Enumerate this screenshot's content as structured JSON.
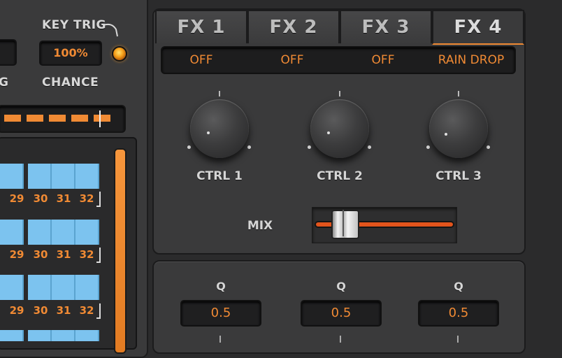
{
  "key_trig": {
    "label": "KEY TRIG",
    "chance_value": "100%",
    "chance_label": "CHANCE",
    "cut_label": "G"
  },
  "steps": {
    "numbers": [
      "29",
      "30",
      "31",
      "32"
    ]
  },
  "fx": {
    "tabs": [
      "FX 1",
      "FX 2",
      "FX 3",
      "FX 4"
    ],
    "active_tab": "FX 4",
    "slots": [
      "OFF",
      "OFF",
      "OFF",
      "RAIN DROP"
    ],
    "knobs": [
      {
        "label": "CTRL 1"
      },
      {
        "label": "CTRL 2"
      },
      {
        "label": "CTRL 3"
      }
    ],
    "mix_label": "MIX"
  },
  "q_section": {
    "label": "Q",
    "values": [
      "0.5",
      "0.5",
      "0.5"
    ]
  },
  "colors": {
    "accent": "#f08a34",
    "step_blue": "#7cc3ef",
    "panel": "#3a3a3b"
  }
}
